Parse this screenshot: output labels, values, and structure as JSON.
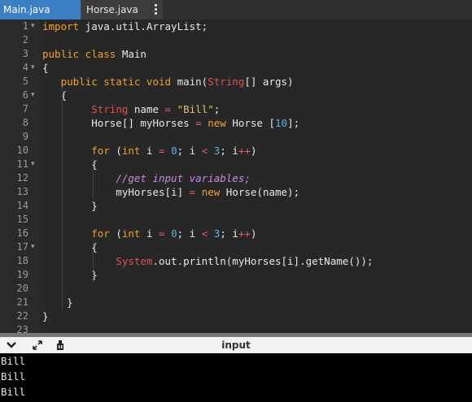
{
  "tabs": [
    {
      "label": "Main.java",
      "active": true
    },
    {
      "label": "Horse.java",
      "active": false
    }
  ],
  "editor": {
    "line_numbers": [
      "1",
      "2",
      "3",
      "4",
      "5",
      "6",
      "7",
      "8",
      "9",
      "10",
      "11",
      "12",
      "13",
      "14",
      "15",
      "16",
      "17",
      "18",
      "19",
      "20",
      "21",
      "22",
      "23"
    ],
    "folds": [
      1,
      4,
      6,
      11,
      17
    ],
    "lines": [
      [
        [
          "kw",
          "import"
        ],
        [
          "t",
          " java.util.ArrayList;"
        ]
      ],
      [],
      [
        [
          "kw",
          "public class"
        ],
        [
          "t",
          " Main"
        ]
      ],
      [
        [
          "t",
          "{"
        ]
      ],
      [
        [
          "t",
          "   "
        ],
        [
          "kw",
          "public static void"
        ],
        [
          "t",
          " main("
        ],
        [
          "ty",
          "String"
        ],
        [
          "t",
          "[] args)"
        ]
      ],
      [
        [
          "t",
          "   {"
        ]
      ],
      [
        [
          "t",
          "        "
        ],
        [
          "ty",
          "String"
        ],
        [
          "t",
          " name "
        ],
        [
          "op",
          "="
        ],
        [
          "t",
          " "
        ],
        [
          "str",
          "\"Bill\""
        ],
        [
          "t",
          ";"
        ]
      ],
      [
        [
          "t",
          "        Horse[] myHorses "
        ],
        [
          "op",
          "="
        ],
        [
          "t",
          " "
        ],
        [
          "kw",
          "new"
        ],
        [
          "t",
          " Horse ["
        ],
        [
          "num",
          "10"
        ],
        [
          "t",
          "];"
        ]
      ],
      [],
      [
        [
          "t",
          "        "
        ],
        [
          "kw",
          "for"
        ],
        [
          "t",
          " ("
        ],
        [
          "kw",
          "int"
        ],
        [
          "t",
          " i "
        ],
        [
          "op",
          "="
        ],
        [
          "t",
          " "
        ],
        [
          "num",
          "0"
        ],
        [
          "t",
          "; i "
        ],
        [
          "op",
          "<"
        ],
        [
          "t",
          " "
        ],
        [
          "num",
          "3"
        ],
        [
          "t",
          "; i"
        ],
        [
          "op",
          "++"
        ],
        [
          "t",
          ")"
        ]
      ],
      [
        [
          "t",
          "        {"
        ]
      ],
      [
        [
          "t",
          "            "
        ],
        [
          "cm",
          "//get input variables;"
        ]
      ],
      [
        [
          "t",
          "            myHorses[i] "
        ],
        [
          "op",
          "="
        ],
        [
          "t",
          " "
        ],
        [
          "kw",
          "new"
        ],
        [
          "t",
          " Horse(name);"
        ]
      ],
      [
        [
          "t",
          "        }"
        ]
      ],
      [],
      [
        [
          "t",
          "        "
        ],
        [
          "kw",
          "for"
        ],
        [
          "t",
          " ("
        ],
        [
          "kw",
          "int"
        ],
        [
          "t",
          " i "
        ],
        [
          "op",
          "="
        ],
        [
          "t",
          " "
        ],
        [
          "num",
          "0"
        ],
        [
          "t",
          "; i "
        ],
        [
          "op",
          "<"
        ],
        [
          "t",
          " "
        ],
        [
          "num",
          "3"
        ],
        [
          "t",
          "; i"
        ],
        [
          "op",
          "++"
        ],
        [
          "t",
          ")"
        ]
      ],
      [
        [
          "t",
          "        {"
        ]
      ],
      [
        [
          "t",
          "            "
        ],
        [
          "ty",
          "System"
        ],
        [
          "t",
          ".out.println(myHorses[i].getName());"
        ]
      ],
      [
        [
          "t",
          "        }"
        ]
      ],
      [],
      [
        [
          "t",
          "    }"
        ]
      ],
      [
        [
          "t",
          "}"
        ]
      ],
      []
    ]
  },
  "console": {
    "label": "input",
    "output": [
      "Bill",
      "Bill",
      "Bill"
    ]
  },
  "icons": {
    "tab_menu": "kebab-menu-icon",
    "collapse": "chevron-down-icon",
    "expand": "expand-arrows-icon",
    "clear": "clear-console-icon"
  },
  "colors": {
    "active_tab": "#3a7fc4",
    "editor_bg": "#272727",
    "keyword": "#f0a030",
    "type": "#e05050",
    "string": "#e0c070",
    "number": "#5fb0e0",
    "comment": "#c98be0"
  }
}
